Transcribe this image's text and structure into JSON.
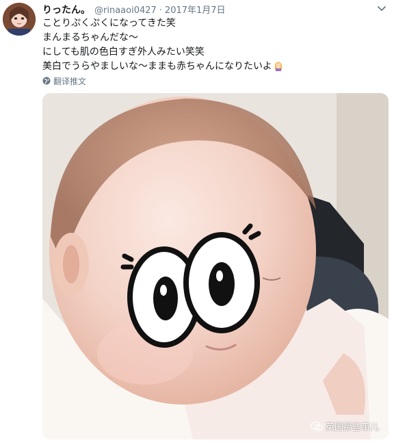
{
  "tweet": {
    "display_name": "りったん。",
    "handle": "@rinaaoi0427",
    "separator": "·",
    "timestamp": "2017年1月7日",
    "lines": [
      "ことりぷくぷくになってきた笑",
      "まんまるちゃんだな〜",
      "にしても肌の色白すぎ外人みたい笑笑",
      "美白でうらやましいな〜ままも赤ちゃんになりたいよ"
    ],
    "translate_label": "翻译推文"
  },
  "watermark": {
    "text": "英国那些事儿"
  },
  "icons": {
    "avatar": "user-avatar",
    "menu": "chevron-down-icon",
    "translate": "globe-icon",
    "emoji": "woman-emoji-icon",
    "wechat": "wechat-icon"
  },
  "colors": {
    "text": "#14171a",
    "secondary": "#657786",
    "background": "#ffffff"
  }
}
